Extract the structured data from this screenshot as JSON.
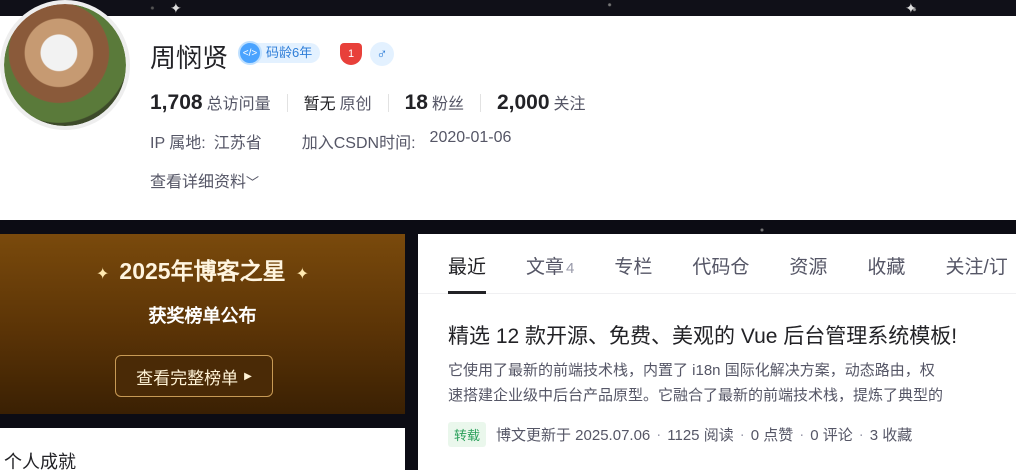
{
  "user": {
    "name": "周悯贤",
    "code_age": "码龄6年",
    "code_icon_text": "</>",
    "gender_icon": "♂",
    "award_icon_text": "1"
  },
  "stats": [
    {
      "value": "1,708",
      "label": "总访问量"
    },
    {
      "value": "暂无",
      "label": "原创"
    },
    {
      "value": "18",
      "label": "粉丝"
    },
    {
      "value": "2,000",
      "label": "关注"
    }
  ],
  "meta": {
    "ip_label": "IP 属地:",
    "ip_value": "江苏省",
    "join_label": "加入CSDN时间:",
    "join_value": "2020-01-06",
    "detail_link": "查看详细资料"
  },
  "promo": {
    "title": "2025年博客之星",
    "subtitle": "获奖榜单公布",
    "button": "查看完整榜单"
  },
  "achievements": {
    "title": "个人成就"
  },
  "tabs": [
    {
      "label": "最近",
      "count": ""
    },
    {
      "label": "文章",
      "count": "4"
    },
    {
      "label": "专栏",
      "count": ""
    },
    {
      "label": "代码仓",
      "count": ""
    },
    {
      "label": "资源",
      "count": ""
    },
    {
      "label": "收藏",
      "count": ""
    },
    {
      "label": "关注/订",
      "count": ""
    }
  ],
  "article": {
    "title": "精选 12 款开源、免费、美观的 Vue 后台管理系统模板!",
    "desc_line1": "它使用了最新的前端技术栈，内置了 i18n 国际化解决方案，动态路由，权",
    "desc_line2": "速搭建企业级中后台产品原型。它融合了最新的前端技术栈，提炼了典型的",
    "tag": "转载",
    "updated": "博文更新于 2025.07.06",
    "reads": "1125 阅读",
    "likes": "0 点赞",
    "comments": "0 评论",
    "favorites": "3 收藏"
  },
  "colors": {
    "accent_blue": "#2f7ed8",
    "award_red": "#e8403a",
    "promo_gold": "#7a4a0c",
    "repost_green": "#2aa05a"
  }
}
